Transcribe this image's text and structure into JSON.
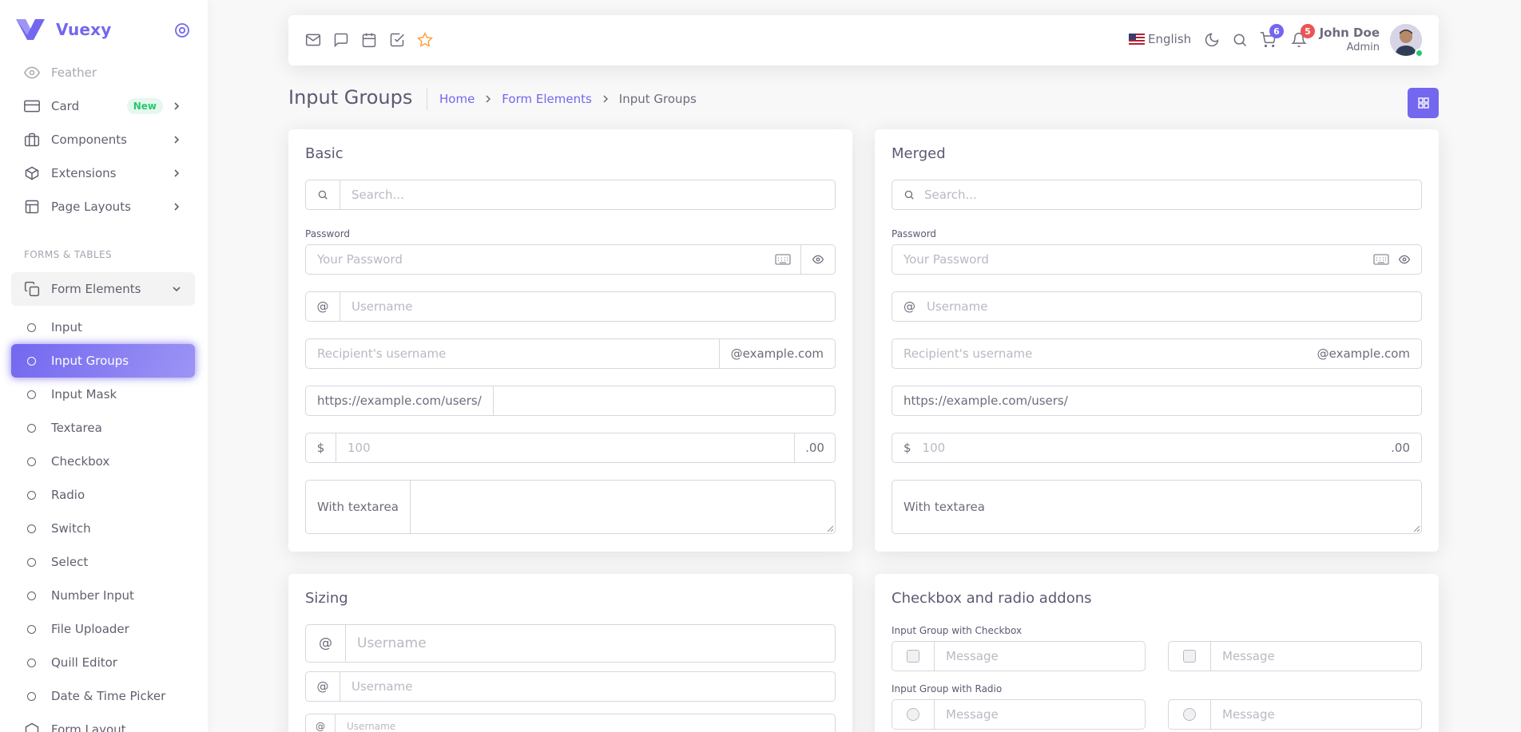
{
  "app": {
    "name": "Vuexy"
  },
  "sidebar": {
    "items_top": [
      {
        "label": "Feather",
        "icon": "eye-icon"
      },
      {
        "label": "Card",
        "icon": "credit-card-icon",
        "badge": "New"
      },
      {
        "label": "Components",
        "icon": "briefcase-icon"
      },
      {
        "label": "Extensions",
        "icon": "package-icon"
      },
      {
        "label": "Page Layouts",
        "icon": "layout-icon"
      }
    ],
    "section_header": "FORMS & TABLES",
    "group_label": "Form Elements",
    "sub_items": [
      "Input",
      "Input Groups",
      "Input Mask",
      "Textarea",
      "Checkbox",
      "Radio",
      "Switch",
      "Select",
      "Number Input",
      "File Uploader",
      "Quill Editor",
      "Date & Time Picker",
      "Form Layout"
    ],
    "active_item": "Input Groups"
  },
  "navbar": {
    "language": "English",
    "cart_count": "6",
    "notification_count": "5",
    "user_name": "John Doe",
    "user_role": "Admin"
  },
  "header": {
    "title": "Input Groups",
    "breadcrumb": [
      "Home",
      "Form Elements",
      "Input Groups"
    ]
  },
  "basic": {
    "title": "Basic",
    "search_placeholder": "Search...",
    "password_label": "Password",
    "password_placeholder": "Your Password",
    "at_symbol": "@",
    "username_placeholder": "Username",
    "recipient_placeholder": "Recipient's username",
    "email_suffix": "@example.com",
    "url_prefix": "https://example.com/users/",
    "dollar": "$",
    "amount_placeholder": "100",
    "cents": ".00",
    "textarea_label": "With textarea"
  },
  "merged": {
    "title": "Merged",
    "search_placeholder": "Search...",
    "password_label": "Password",
    "password_placeholder": "Your Password",
    "at_symbol": "@",
    "username_placeholder": "Username",
    "recipient_placeholder": "Recipient's username",
    "email_suffix": "@example.com",
    "url_prefix": "https://example.com/users/",
    "dollar": "$",
    "amount_placeholder": "100",
    "cents": ".00",
    "textarea_label": "With textarea"
  },
  "sizing": {
    "title": "Sizing",
    "at_symbol": "@",
    "username_placeholder": "Username"
  },
  "addons": {
    "title": "Checkbox and radio addons",
    "checkbox_label": "Input Group with Checkbox",
    "radio_label": "Input Group with Radio",
    "message_placeholder": "Message"
  },
  "colors": {
    "primary": "#7367f0",
    "success": "#28c76f",
    "danger": "#ea5455",
    "warning": "#ff9f43"
  }
}
